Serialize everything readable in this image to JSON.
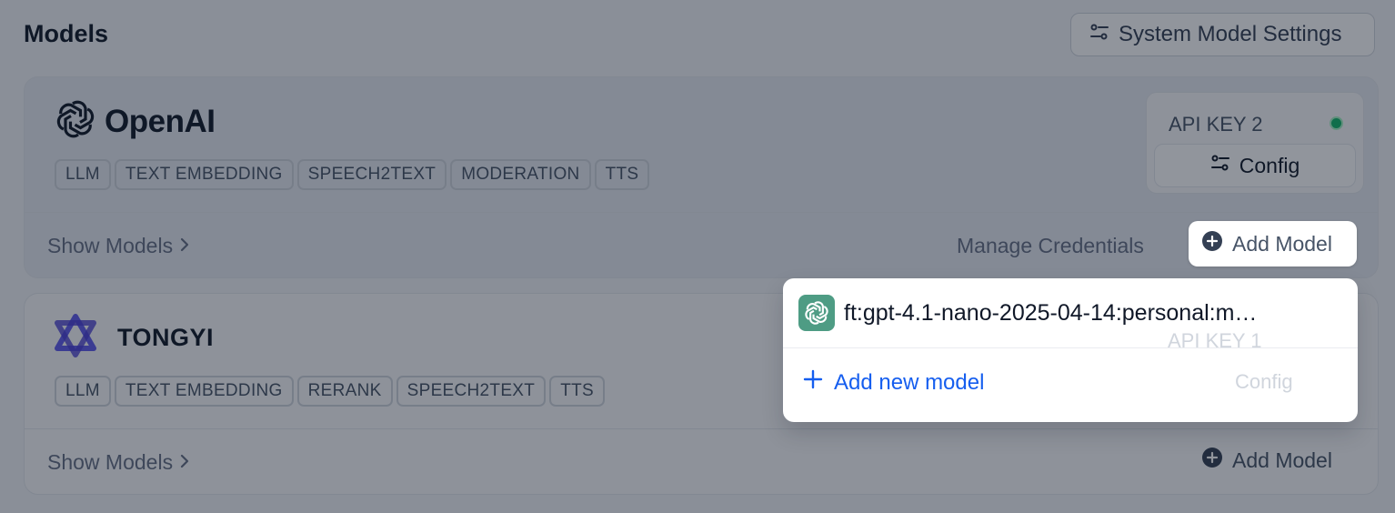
{
  "page": {
    "title": "Models"
  },
  "toolbar": {
    "system_settings_label": "System Model Settings"
  },
  "providers": [
    {
      "name": "OpenAI",
      "tags": [
        "LLM",
        "TEXT EMBEDDING",
        "SPEECH2TEXT",
        "MODERATION",
        "TTS"
      ],
      "credential": {
        "label": "API KEY 2",
        "status_color": "#12b76a"
      },
      "config_label": "Config",
      "show_models_label": "Show Models",
      "manage_credentials_label": "Manage Credentials",
      "add_model_label": "Add Model"
    },
    {
      "name": "TONGYI",
      "tags": [
        "LLM",
        "TEXT EMBEDDING",
        "RERANK",
        "SPEECH2TEXT",
        "TTS"
      ],
      "credential": {
        "label": "API KEY 1"
      },
      "config_label": "Config",
      "show_models_label": "Show Models",
      "add_model_label": "Add Model"
    }
  ],
  "dropdown": {
    "items": [
      {
        "label": "ft:gpt-4.1-nano-2025-04-14:personal:m…",
        "icon": "openai-icon"
      }
    ],
    "add_new_label": "Add new model"
  },
  "colors": {
    "accent": "#155eef",
    "overlay": "rgba(16,24,40,0.46)",
    "gpt_badge": "#4e9c84"
  }
}
